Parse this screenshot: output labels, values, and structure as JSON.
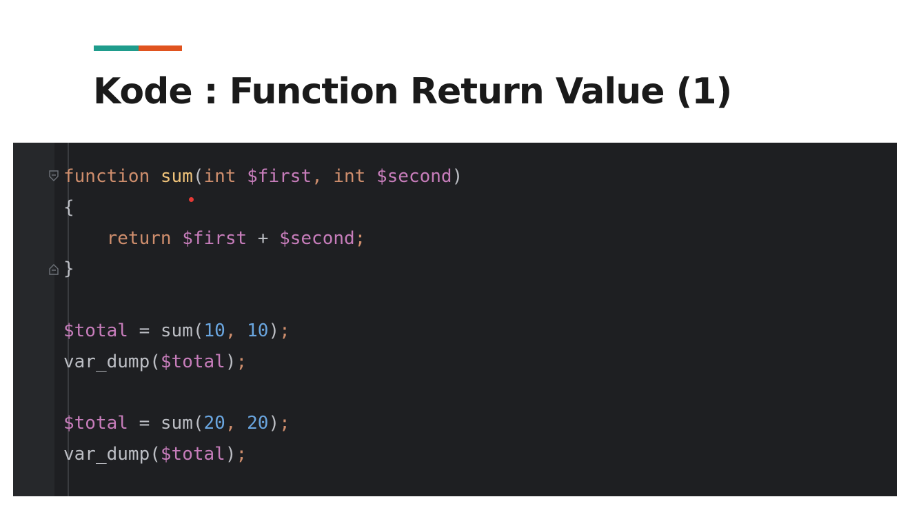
{
  "slide": {
    "title": "Kode : Function Return Value (1)"
  },
  "accent_colors": {
    "teal": "#1f9c8c",
    "orange": "#e0531f"
  },
  "syntax_colors": {
    "keyword": "#cf8e6d",
    "function_name": "#f0c37a",
    "variable": "#c77dbb",
    "number": "#6aa6e0",
    "punctuation": "#bcbec4",
    "default": "#bcbec4"
  },
  "code": {
    "lines": [
      [
        {
          "t": "function",
          "c": "keyword"
        },
        {
          "t": " ",
          "c": "default"
        },
        {
          "t": "sum",
          "c": "function_name"
        },
        {
          "t": "(",
          "c": "punctuation"
        },
        {
          "t": "int",
          "c": "keyword"
        },
        {
          "t": " ",
          "c": "default"
        },
        {
          "t": "$first",
          "c": "variable"
        },
        {
          "t": ", ",
          "c": "keyword"
        },
        {
          "t": "int",
          "c": "keyword"
        },
        {
          "t": " ",
          "c": "default"
        },
        {
          "t": "$second",
          "c": "variable"
        },
        {
          "t": ")",
          "c": "punctuation"
        }
      ],
      [
        {
          "t": "{",
          "c": "punctuation"
        }
      ],
      [
        {
          "t": "    ",
          "c": "default"
        },
        {
          "t": "return",
          "c": "keyword"
        },
        {
          "t": " ",
          "c": "default"
        },
        {
          "t": "$first",
          "c": "variable"
        },
        {
          "t": " + ",
          "c": "punctuation"
        },
        {
          "t": "$second",
          "c": "variable"
        },
        {
          "t": ";",
          "c": "keyword"
        }
      ],
      [
        {
          "t": "}",
          "c": "punctuation"
        }
      ],
      [],
      [
        {
          "t": "$total",
          "c": "variable"
        },
        {
          "t": " = ",
          "c": "punctuation"
        },
        {
          "t": "sum",
          "c": "punctuation"
        },
        {
          "t": "(",
          "c": "punctuation"
        },
        {
          "t": "10",
          "c": "number"
        },
        {
          "t": ", ",
          "c": "keyword"
        },
        {
          "t": "10",
          "c": "number"
        },
        {
          "t": ")",
          "c": "punctuation"
        },
        {
          "t": ";",
          "c": "keyword"
        }
      ],
      [
        {
          "t": "var_dump",
          "c": "punctuation"
        },
        {
          "t": "(",
          "c": "punctuation"
        },
        {
          "t": "$total",
          "c": "variable"
        },
        {
          "t": ")",
          "c": "punctuation"
        },
        {
          "t": ";",
          "c": "keyword"
        }
      ],
      [],
      [
        {
          "t": "$total",
          "c": "variable"
        },
        {
          "t": " = ",
          "c": "punctuation"
        },
        {
          "t": "sum",
          "c": "punctuation"
        },
        {
          "t": "(",
          "c": "punctuation"
        },
        {
          "t": "20",
          "c": "number"
        },
        {
          "t": ", ",
          "c": "keyword"
        },
        {
          "t": "20",
          "c": "number"
        },
        {
          "t": ")",
          "c": "punctuation"
        },
        {
          "t": ";",
          "c": "keyword"
        }
      ],
      [
        {
          "t": "var_dump",
          "c": "punctuation"
        },
        {
          "t": "(",
          "c": "punctuation"
        },
        {
          "t": "$total",
          "c": "variable"
        },
        {
          "t": ")",
          "c": "punctuation"
        },
        {
          "t": ";",
          "c": "keyword"
        }
      ]
    ],
    "fold_markers": [
      {
        "line": 0,
        "icon": "fold-open-icon"
      },
      {
        "line": 3,
        "icon": "fold-close-icon"
      }
    ]
  }
}
